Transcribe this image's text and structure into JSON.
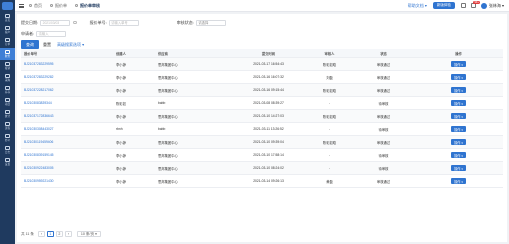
{
  "sidebar": {
    "items": [
      {
        "label": "首页",
        "icon": "home-icon"
      },
      {
        "label": "客户",
        "icon": "customer-icon"
      },
      {
        "label": "订单",
        "icon": "order-icon"
      },
      {
        "label": "财务",
        "icon": "finance-icon"
      },
      {
        "label": "报销",
        "icon": "reimburse-icon"
      },
      {
        "label": "采购",
        "icon": "purchase-icon"
      },
      {
        "label": "库存",
        "icon": "stock-icon"
      },
      {
        "label": "项目",
        "icon": "project-icon"
      },
      {
        "label": "统计",
        "icon": "stats-icon"
      },
      {
        "label": "流程",
        "icon": "flow-icon"
      },
      {
        "label": "办公",
        "icon": "office-icon"
      },
      {
        "label": "日志",
        "icon": "log-icon"
      },
      {
        "label": "设置",
        "icon": "settings-icon"
      }
    ]
  },
  "topbar": {
    "tabs": [
      "首页",
      "报价单",
      "报价单审核"
    ],
    "help_link": "帮助文档 ▾",
    "upgrade_btn": "新版体验",
    "badge_count": "99+",
    "user_name": "张林海 ▾"
  },
  "filters": {
    "label1": "提交日期:",
    "placeholder1": "2021/03/03",
    "label2": "报价单号:",
    "placeholder2": "请输入单号",
    "label3": "审核状态:",
    "placeholder3": "请选择",
    "label4": "申请者:",
    "placeholder4": "请输入",
    "search_label": "查询",
    "reset_label": "重置",
    "expand_label": "高级搜索选项 ▾"
  },
  "table": {
    "headers": [
      "报价单号",
      "创建人",
      "供应商",
      "提交时间",
      "审核人",
      "状态",
      "操作"
    ],
    "rows": [
      {
        "no": "BJ21037283229595",
        "creator": "李小静",
        "supplier": "思邦集团中心",
        "time": "2021-03-17 16:54:43",
        "reviewer": "陈彩如晗",
        "status": "审核通过",
        "op": "操作 ▾"
      },
      {
        "no": "BJ21037283229282",
        "creator": "李小静",
        "supplier": "思邦集团中心",
        "time": "2021-03-16 16:07:32",
        "reviewer": "刘磊",
        "status": "审核通过",
        "op": "操作 ▾"
      },
      {
        "no": "BJ21037228217062",
        "creator": "李小静",
        "supplier": "思邦集团中心",
        "time": "2021-03-16 09:15:44",
        "reviewer": "陈彩如晗",
        "status": "审核通过",
        "op": "操作 ▾"
      },
      {
        "no": "BJ2103083839344",
        "creator": "陈彩如",
        "supplier": "babb",
        "time": "2021-03-08 08:39:27",
        "reviewer": "-",
        "status": "待审核",
        "op": "操作 ▾"
      },
      {
        "no": "BJ21037172836643",
        "creator": "李小静",
        "supplier": "思邦集团中心",
        "time": "2021-03-10 14:27:03",
        "reviewer": "陈彩如晗",
        "status": "审核通过",
        "op": "操作 ▾"
      },
      {
        "no": "BJ21030308443027",
        "creator": "rbnh",
        "supplier": "babb",
        "time": "2021-03-11 13:26:52",
        "reviewer": "-",
        "status": "待审核",
        "op": "操作 ▾"
      },
      {
        "no": "BJ21030119459406",
        "creator": "李小静",
        "supplier": "思邦集团中心",
        "time": "2021-03-10 09:39:04",
        "reviewer": "陈彩如晗",
        "status": "审核通过",
        "op": "操作 ▾"
      },
      {
        "no": "BJ21030839159145",
        "creator": "李小静",
        "supplier": "思邦集团中心",
        "time": "2021-03-10 17:58:14",
        "reviewer": "-",
        "status": "待审核",
        "op": "操作 ▾"
      },
      {
        "no": "BJ21030922483005",
        "creator": "李小静",
        "supplier": "思邦集团中心",
        "time": "2021-03-10 08:24:02",
        "reviewer": "-",
        "status": "待审核",
        "op": "操作 ▾"
      },
      {
        "no": "BJ21030959221430",
        "creator": "李小静",
        "supplier": "思邦集团中心",
        "time": "2021-03-14 09:26:13",
        "reviewer": "黄磊",
        "status": "审核通过",
        "op": "操作 ▾"
      }
    ]
  },
  "pager": {
    "total": "共 11 条",
    "prev": "‹",
    "pages": [
      "1",
      "2"
    ],
    "next": "›",
    "size": "10 条/页 ▾"
  }
}
